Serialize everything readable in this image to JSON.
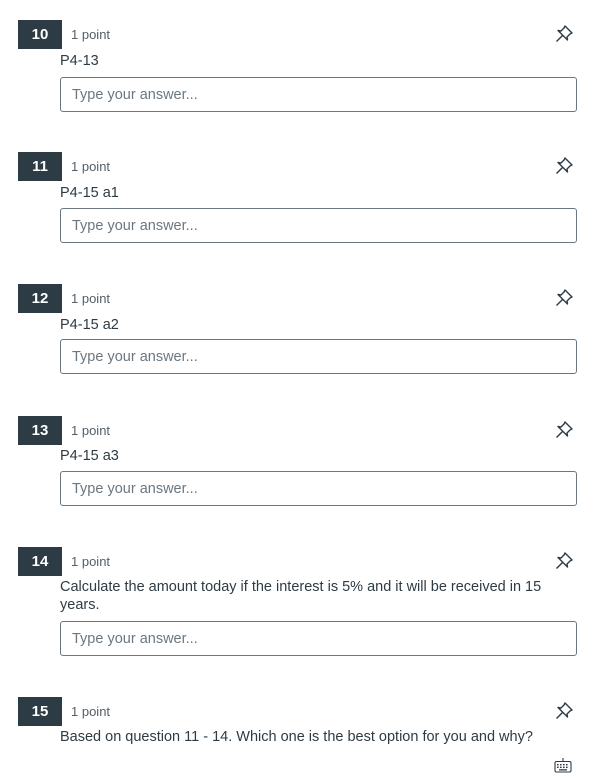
{
  "questions": [
    {
      "number": "10",
      "points": "1 point",
      "text": "P4-13",
      "placeholder": "Type your answer..."
    },
    {
      "number": "11",
      "points": "1 point",
      "text": "P4-15 a1",
      "placeholder": "Type your answer..."
    },
    {
      "number": "12",
      "points": "1 point",
      "text": "P4-15 a2",
      "placeholder": "Type your answer..."
    },
    {
      "number": "13",
      "points": "1 point",
      "text": "P4-15 a3",
      "placeholder": "Type your answer..."
    },
    {
      "number": "14",
      "points": "1 point",
      "text": "Calculate the amount today if the interest is 5% and it will be received in 15 years.",
      "placeholder": "Type your answer..."
    },
    {
      "number": "15",
      "points": "1 point",
      "text": "Based on question 11 - 14.  Which one is the best option for you and why?"
    }
  ],
  "icons": {
    "flag": "pin-icon",
    "keyboard": "keyboard-icon"
  }
}
